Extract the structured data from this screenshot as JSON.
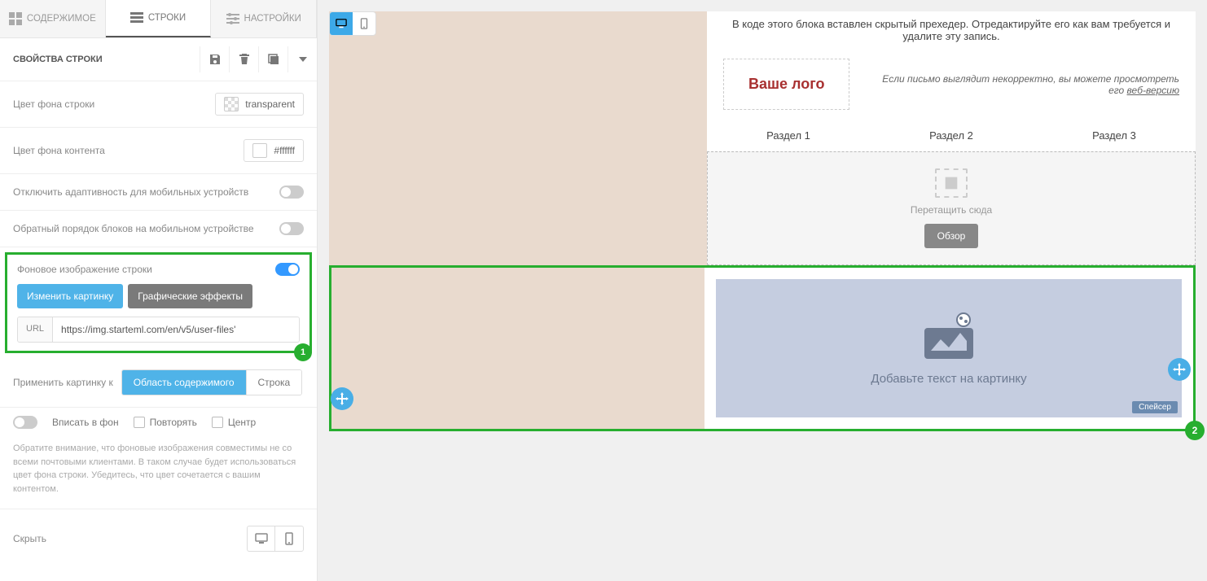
{
  "sidebar": {
    "tabs": {
      "content": "СОДЕРЖИМОЕ",
      "rows": "СТРОКИ",
      "settings": "НАСТРОЙКИ"
    },
    "header": {
      "title": "СВОЙСТВА СТРОКИ"
    },
    "bg_row_label": "Цвет фона строки",
    "bg_row_value": "transparent",
    "bg_content_label": "Цвет фона контента",
    "bg_content_value": "#ffffff",
    "disable_responsive": "Отключить адаптивность для мобильных устройств",
    "reverse_mobile": "Обратный порядок блоков на мобильном устройстве",
    "bg_image": {
      "label": "Фоновое изображение строки",
      "btn_change": "Изменить картинку",
      "btn_effects": "Графические эффекты",
      "url_label": "URL",
      "url_value": "https://img.starteml.com/en/v5/user-files'"
    },
    "apply_label": "Применить картинку к",
    "apply_content": "Область содержимого",
    "apply_row": "Строка",
    "fit_label": "Вписать в фон",
    "repeat_label": "Повторять",
    "center_label": "Центр",
    "info": "Обратите внимание, что фоновые изображения совместимы не со всеми почтовыми клиентами. В таком случае будет использоваться цвет фона строки. Убедитесь, что цвет сочетается с вашим контентом.",
    "hide_label": "Скрыть"
  },
  "canvas": {
    "preheader": "В коде этого блока вставлен скрытый прехедер. Отредактируйте его как вам требуется и удалите эту запись.",
    "logo": "Ваше лого",
    "web_version_text": "Если письмо выглядит некорректно, вы можете просмотреть его ",
    "web_version_link": "веб-версию",
    "nav1": "Раздел 1",
    "nav2": "Раздел 2",
    "nav3": "Раздел 3",
    "drop_text": "Перетащить сюда",
    "browse": "Обзор",
    "banner_caption": "Добавьте текст на картинку",
    "spacer": "Спейсер"
  },
  "badges": {
    "one": "1",
    "two": "2"
  }
}
